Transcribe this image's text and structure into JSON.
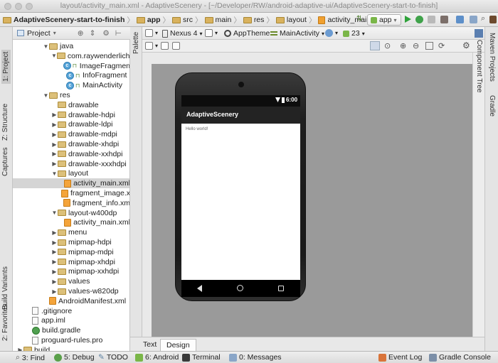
{
  "window": {
    "title": "layout/activity_main.xml - AdaptiveScenery - [~/Developer/RW/android-adaptive-ui/AdaptiveScenery-start-to-finish]"
  },
  "breadcrumbs": [
    "AdaptiveScenery-start-to-finish",
    "app",
    "src",
    "main",
    "res",
    "layout",
    "activity_main.xml"
  ],
  "run_config": {
    "label": "app"
  },
  "left_tabs": {
    "project": "1: Project",
    "structure": "Z: Structure",
    "captures": "Captures",
    "build_variants": "Build Variants",
    "favorites": "2: Favorites"
  },
  "right_tabs": {
    "maven": "Maven Projects",
    "gradle": "Gradle"
  },
  "project_panel": {
    "view_label": "Project",
    "tree": [
      {
        "label": "java",
        "indent": 3,
        "type": "folder",
        "expanded": true
      },
      {
        "label": "com.raywenderlich.a",
        "indent": 4,
        "type": "folder",
        "expanded": true
      },
      {
        "label": "ImageFragmen",
        "indent": 5,
        "type": "class"
      },
      {
        "label": "InfoFragment",
        "indent": 5,
        "type": "class"
      },
      {
        "label": "MainActivity",
        "indent": 5,
        "type": "class"
      },
      {
        "label": "res",
        "indent": 3,
        "type": "folder",
        "expanded": true
      },
      {
        "label": "drawable",
        "indent": 4,
        "type": "folder",
        "leaf": true
      },
      {
        "label": "drawable-hdpi",
        "indent": 4,
        "type": "folder"
      },
      {
        "label": "drawable-ldpi",
        "indent": 4,
        "type": "folder"
      },
      {
        "label": "drawable-mdpi",
        "indent": 4,
        "type": "folder"
      },
      {
        "label": "drawable-xhdpi",
        "indent": 4,
        "type": "folder"
      },
      {
        "label": "drawable-xxhdpi",
        "indent": 4,
        "type": "folder"
      },
      {
        "label": "drawable-xxxhdpi",
        "indent": 4,
        "type": "folder"
      },
      {
        "label": "layout",
        "indent": 4,
        "type": "folder",
        "expanded": true
      },
      {
        "label": "activity_main.xml",
        "indent": 5,
        "type": "xml",
        "selected": true
      },
      {
        "label": "fragment_image.x",
        "indent": 5,
        "type": "xml"
      },
      {
        "label": "fragment_info.xm",
        "indent": 5,
        "type": "xml"
      },
      {
        "label": "layout-w400dp",
        "indent": 4,
        "type": "folder",
        "expanded": true
      },
      {
        "label": "activity_main.xml",
        "indent": 5,
        "type": "xml"
      },
      {
        "label": "menu",
        "indent": 4,
        "type": "folder"
      },
      {
        "label": "mipmap-hdpi",
        "indent": 4,
        "type": "folder"
      },
      {
        "label": "mipmap-mdpi",
        "indent": 4,
        "type": "folder"
      },
      {
        "label": "mipmap-xhdpi",
        "indent": 4,
        "type": "folder"
      },
      {
        "label": "mipmap-xxhdpi",
        "indent": 4,
        "type": "folder"
      },
      {
        "label": "values",
        "indent": 4,
        "type": "folder"
      },
      {
        "label": "values-w820dp",
        "indent": 4,
        "type": "folder"
      },
      {
        "label": "AndroidManifest.xml",
        "indent": 3,
        "type": "xml",
        "leaf": true
      },
      {
        "label": ".gitignore",
        "indent": 1,
        "type": "file",
        "leaf": true
      },
      {
        "label": "app.iml",
        "indent": 1,
        "type": "file",
        "leaf": true
      },
      {
        "label": "build.gradle",
        "indent": 1,
        "type": "gradle",
        "leaf": true
      },
      {
        "label": "proguard-rules.pro",
        "indent": 1,
        "type": "file",
        "leaf": true
      },
      {
        "label": "build",
        "indent": 0,
        "type": "folder"
      }
    ]
  },
  "designer_toolbar": {
    "device": "Nexus 4",
    "theme": "AppTheme",
    "activity": "MainActivity",
    "api_level": "23",
    "palette_label": "Palette",
    "component_tree_label": "Component Tree"
  },
  "preview": {
    "status_time": "6:00",
    "app_title": "AdaptiveScenery",
    "hello_text": "Hello world!"
  },
  "editor_tabs": [
    "Text",
    "Design"
  ],
  "active_editor_tab": "Design",
  "status_bar": {
    "find": "3: Find",
    "debug": "5: Debug",
    "todo": "TODO",
    "android": "6: Android",
    "terminal": "Terminal",
    "messages": "0: Messages",
    "event_log": "Event Log",
    "gradle_console": "Gradle Console"
  },
  "colors": {
    "selection": "#d5d5d5",
    "folder": "#dcc07a",
    "xml_icon": "#f4a43a",
    "run_green": "#2ea23a",
    "canvas_bg": "#9a9a9a"
  }
}
